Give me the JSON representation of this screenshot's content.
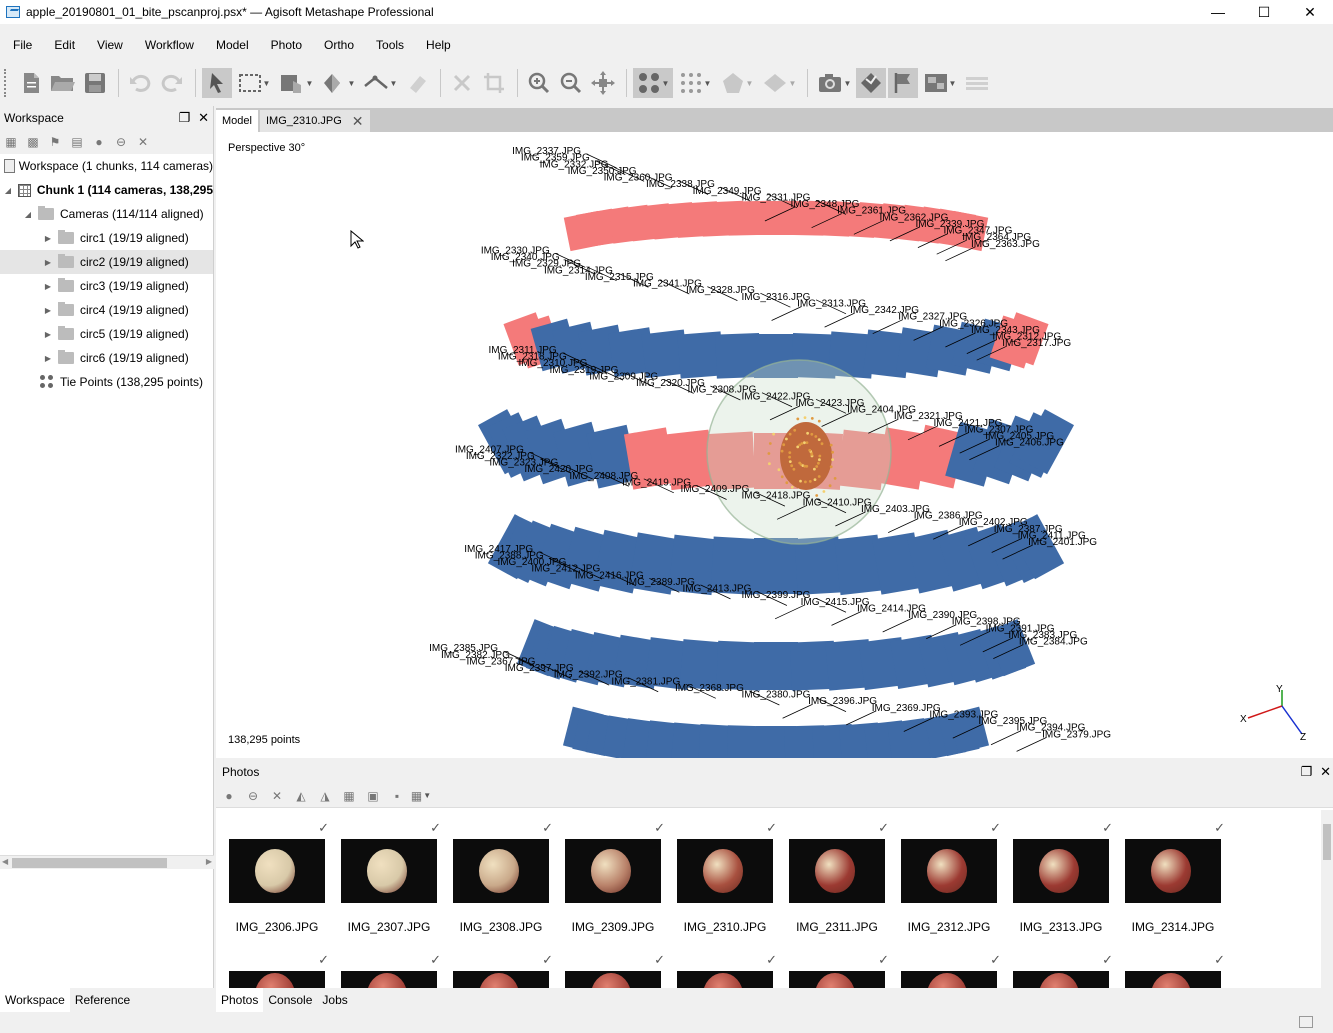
{
  "window": {
    "title": "apple_20190801_01_bite_pscanproj.psx* — Agisoft Metashape Professional",
    "minimize": "—",
    "maximize": "☐",
    "close": "✕"
  },
  "menu": [
    "File",
    "Edit",
    "View",
    "Workflow",
    "Model",
    "Photo",
    "Ortho",
    "Tools",
    "Help"
  ],
  "toolbar_icons": [
    "new-icon",
    "open-icon",
    "save-icon",
    "undo-icon",
    "redo-icon",
    "navigation-icon",
    "rectangle-selection-icon",
    "resize-region-icon",
    "rotate-region-icon",
    "ruler-icon",
    "eraser-icon",
    "delete-icon",
    "crop-icon",
    "zoom-in-icon",
    "zoom-out-icon",
    "reset-view-icon",
    "point-cloud-icon",
    "dense-cloud-icon",
    "shaded-model-icon",
    "tiled-model-icon",
    "show-cameras-icon",
    "show-region-icon",
    "show-markers-icon",
    "show-images-icon",
    "show-trackball-icon"
  ],
  "workspace": {
    "title": "Workspace",
    "root": "Workspace (1 chunks, 114 cameras)",
    "chunk": "Chunk 1 (114 cameras, 138,295",
    "cameras": "Cameras (114/114 aligned)",
    "groups": [
      {
        "label": "circ1 (19/19 aligned)"
      },
      {
        "label": "circ2 (19/19 aligned)"
      },
      {
        "label": "circ3 (19/19 aligned)"
      },
      {
        "label": "circ4 (19/19 aligned)"
      },
      {
        "label": "circ5 (19/19 aligned)"
      },
      {
        "label": "circ6 (19/19 aligned)"
      }
    ],
    "tie_points": "Tie Points (138,295 points)"
  },
  "left_tabs": [
    "Workspace",
    "Reference"
  ],
  "model_tabs": {
    "model": "Model",
    "image": "IMG_2310.JPG"
  },
  "viewport": {
    "projection": "Perspective 30°",
    "points": "138,295 points",
    "axes": {
      "x": "X",
      "y": "Y",
      "z": "Z"
    },
    "camera_labels": [
      {
        "t": "IMG_2337.JPG"
      },
      {
        "t": "IMG_2359.JPG"
      },
      {
        "t": "IMG_2332.JPG"
      },
      {
        "t": "IMG_2350.JPG"
      },
      {
        "t": "IMG_2360.JPG"
      },
      {
        "t": "IMG_2338.JPG"
      },
      {
        "t": "IMG_2349.JPG"
      },
      {
        "t": "IMG_2331.JPG"
      },
      {
        "t": "IMG_2348.JPG"
      },
      {
        "t": "IMG_2361.JPG"
      },
      {
        "t": "IMG_2362.JPG"
      },
      {
        "t": "IMG_2339.JPG"
      },
      {
        "t": "IMG_2347.JPG"
      },
      {
        "t": "IMG_2364.JPG"
      },
      {
        "t": "IMG_2363.JPG"
      },
      {
        "t": "IMG_2330.JPG"
      },
      {
        "t": "IMG_2340.JPG"
      },
      {
        "t": "IMG_2329.JPG"
      },
      {
        "t": "IMG_2314.JPG"
      },
      {
        "t": "IMG_2315.JPG"
      },
      {
        "t": "IMG_2341.JPG"
      },
      {
        "t": "IMG_2328.JPG"
      },
      {
        "t": "IMG_2316.JPG"
      },
      {
        "t": "IMG_2313.JPG"
      },
      {
        "t": "IMG_2342.JPG"
      },
      {
        "t": "IMG_2327.JPG"
      },
      {
        "t": "IMG_2326.JPG"
      },
      {
        "t": "IMG_2343.JPG"
      },
      {
        "t": "IMG_2312.JPG"
      },
      {
        "t": "IMG_2317.JPG"
      },
      {
        "t": "IMG_2311.JPG"
      },
      {
        "t": "IMG_2318.JPG"
      },
      {
        "t": "IMG_2310.JPG"
      },
      {
        "t": "IMG_2319.JPG"
      },
      {
        "t": "IMG_2309.JPG"
      },
      {
        "t": "IMG_2320.JPG"
      },
      {
        "t": "IMG_2308.JPG"
      },
      {
        "t": "IMG_2422.JPG"
      },
      {
        "t": "IMG_2423.JPG"
      },
      {
        "t": "IMG_2404.JPG"
      },
      {
        "t": "IMG_2321.JPG"
      },
      {
        "t": "IMG_2421.JPG"
      },
      {
        "t": "IMG_2307.JPG"
      },
      {
        "t": "IMG_2405.JPG"
      },
      {
        "t": "IMG_2406.JPG"
      },
      {
        "t": "IMG_2407.JPG"
      },
      {
        "t": "IMG_2322.JPG"
      },
      {
        "t": "IMG_2323.JPG"
      },
      {
        "t": "IMG_2420.JPG"
      },
      {
        "t": "IMG_2408.JPG"
      },
      {
        "t": "IMG_2419.JPG"
      },
      {
        "t": "IMG_2409.JPG"
      },
      {
        "t": "IMG_2418.JPG"
      },
      {
        "t": "IMG_2410.JPG"
      },
      {
        "t": "IMG_2403.JPG"
      },
      {
        "t": "IMG_2386.JPG"
      },
      {
        "t": "IMG_2402.JPG"
      },
      {
        "t": "IMG_2387.JPG"
      },
      {
        "t": "IMG_2411.JPG"
      },
      {
        "t": "IMG_2401.JPG"
      },
      {
        "t": "IMG_2417.JPG"
      },
      {
        "t": "IMG_2388.JPG"
      },
      {
        "t": "IMG_2400.JPG"
      },
      {
        "t": "IMG_2412.JPG"
      },
      {
        "t": "IMG_2416.JPG"
      },
      {
        "t": "IMG_2389.JPG"
      },
      {
        "t": "IMG_2413.JPG"
      },
      {
        "t": "IMG_2399.JPG"
      },
      {
        "t": "IMG_2415.JPG"
      },
      {
        "t": "IMG_2414.JPG"
      },
      {
        "t": "IMG_2390.JPG"
      },
      {
        "t": "IMG_2398.JPG"
      },
      {
        "t": "IMG_2391.JPG"
      },
      {
        "t": "IMG_2383.JPG"
      },
      {
        "t": "IMG_2384.JPG"
      },
      {
        "t": "IMG_2385.JPG"
      },
      {
        "t": "IMG_2382.JPG"
      },
      {
        "t": "IMG_2367.JPG"
      },
      {
        "t": "IMG_2397.JPG"
      },
      {
        "t": "IMG_2392.JPG"
      },
      {
        "t": "IMG_2381.JPG"
      },
      {
        "t": "IMG_2368.JPG"
      },
      {
        "t": "IMG_2380.JPG"
      },
      {
        "t": "IMG_2396.JPG"
      },
      {
        "t": "IMG_2369.JPG"
      },
      {
        "t": "IMG_2393.JPG"
      },
      {
        "t": "IMG_2395.JPG"
      },
      {
        "t": "IMG_2394.JPG"
      },
      {
        "t": "IMG_2379.JPG"
      }
    ]
  },
  "photos": {
    "title": "Photos",
    "items": [
      {
        "name": "IMG_2306.JPG",
        "aligned": "✓",
        "fruit": "#d8c9a8"
      },
      {
        "name": "IMG_2307.JPG",
        "aligned": "✓",
        "fruit": "#d8c9a8"
      },
      {
        "name": "IMG_2308.JPG",
        "aligned": "✓",
        "fruit": "#c9a98a"
      },
      {
        "name": "IMG_2309.JPG",
        "aligned": "✓",
        "fruit": "#b9826a"
      },
      {
        "name": "IMG_2310.JPG",
        "aligned": "✓",
        "fruit": "#a8503f"
      },
      {
        "name": "IMG_2311.JPG",
        "aligned": "✓",
        "fruit": "#9c3a32"
      },
      {
        "name": "IMG_2312.JPG",
        "aligned": "✓",
        "fruit": "#9c3a32"
      },
      {
        "name": "IMG_2313.JPG",
        "aligned": "✓",
        "fruit": "#9c3a32"
      },
      {
        "name": "IMG_2314.JPG",
        "aligned": "✓",
        "fruit": "#9c3a32"
      }
    ],
    "second_row_checks": [
      "✓",
      "✓",
      "✓",
      "✓",
      "✓",
      "✓",
      "✓",
      "✓",
      "✓"
    ]
  },
  "bottom_tabs": [
    "Photos",
    "Console",
    "Jobs"
  ],
  "colors": {
    "camera_blue": "#3f6ba7",
    "camera_red": "#f47a7a"
  }
}
